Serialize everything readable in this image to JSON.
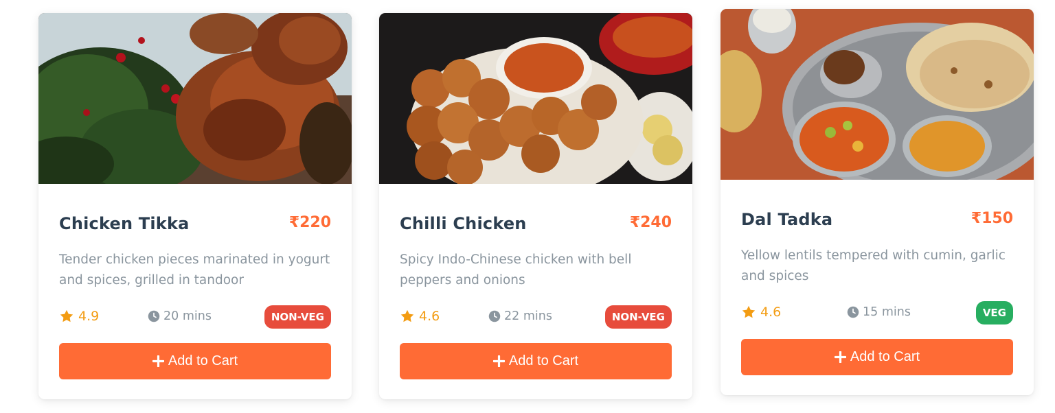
{
  "colors": {
    "accent": "#ff6b35",
    "title": "#2c3e50",
    "muted": "#8a959e",
    "rating": "#f39c12",
    "non_veg": "#e74c3c",
    "veg": "#27ae60"
  },
  "cards": [
    {
      "image": "chicken-tikka-photo",
      "title": "Chicken Tikka",
      "price": "₹220",
      "description": "Tender chicken pieces marinated in yogurt and spices, grilled in tandoor",
      "rating": "4.9",
      "time": "20 mins",
      "badge": "NON-VEG",
      "button_label": "Add to Cart",
      "rating_icon": "star-icon",
      "time_icon": "clock-icon",
      "button_icon": "plus-icon"
    },
    {
      "image": "chilli-chicken-photo",
      "title": "Chilli Chicken",
      "price": "₹240",
      "description": "Spicy Indo-Chinese chicken with bell peppers and onions",
      "rating": "4.6",
      "time": "22 mins",
      "badge": "NON-VEG",
      "button_label": "Add to Cart",
      "rating_icon": "star-icon",
      "time_icon": "clock-icon",
      "button_icon": "plus-icon"
    },
    {
      "image": "dal-tadka-photo",
      "title": "Dal Tadka",
      "price": "₹150",
      "description": "Yellow lentils tempered with cumin, garlic and spices",
      "rating": "4.6",
      "time": "15 mins",
      "badge": "VEG",
      "button_label": "Add to Cart",
      "rating_icon": "star-icon",
      "time_icon": "clock-icon",
      "button_icon": "plus-icon"
    }
  ]
}
